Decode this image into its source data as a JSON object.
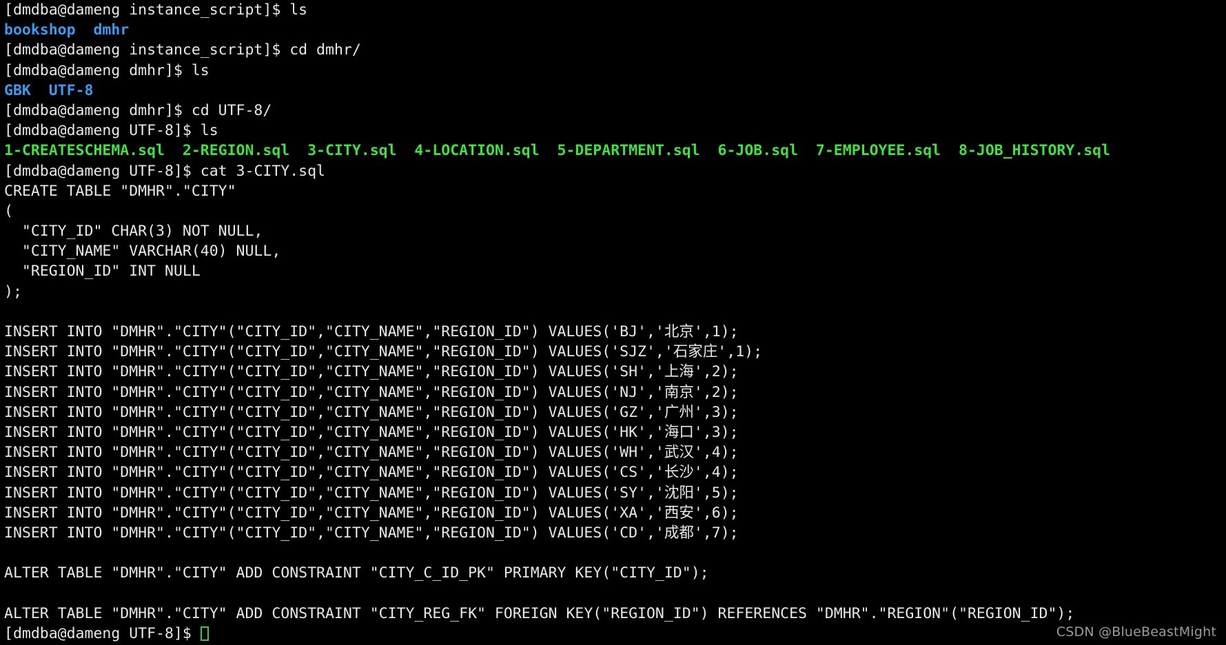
{
  "terminal": {
    "title": "dmdba@dameng terminal",
    "colors": {
      "background": "#000000",
      "foreground": "#e8e8e8",
      "directory": "#3b9bf0",
      "executable": "#3ee33e",
      "cursor": "#33cc33",
      "watermark": "#9b9b9b"
    },
    "prompts": {
      "instance_script": "[dmdba@dameng instance_script]$ ",
      "dmhr": "[dmdba@dameng dmhr]$ ",
      "utf8": "[dmdba@dameng UTF-8]$ "
    },
    "commands": {
      "ls": "ls",
      "cd_dmhr": "cd dmhr/",
      "cd_utf8": "cd UTF-8/",
      "cat_city": "cat 3-CITY.sql"
    },
    "listings": {
      "instance_script": [
        "bookshop",
        "dmhr"
      ],
      "dmhr": [
        "GBK",
        "UTF-8"
      ],
      "utf8": [
        "1-CREATESCHEMA.sql",
        "2-REGION.sql",
        "3-CITY.sql",
        "4-LOCATION.sql",
        "5-DEPARTMENT.sql",
        "6-JOB.sql",
        "7-EMPLOYEE.sql",
        "8-JOB_HISTORY.sql"
      ]
    },
    "file_content": {
      "create_table_header": "CREATE TABLE \"DMHR\".\"CITY\"",
      "open_paren": "(",
      "columns": [
        "  \"CITY_ID\" CHAR(3) NOT NULL,",
        "  \"CITY_NAME\" VARCHAR(40) NULL,",
        "  \"REGION_ID\" INT NULL"
      ],
      "close_paren": ");",
      "insert_prefix": "INSERT INTO \"DMHR\".\"CITY\"(\"CITY_ID\",\"CITY_NAME\",\"REGION_ID\") VALUES(",
      "inserts": [
        "INSERT INTO \"DMHR\".\"CITY\"(\"CITY_ID\",\"CITY_NAME\",\"REGION_ID\") VALUES('BJ','北京',1);",
        "INSERT INTO \"DMHR\".\"CITY\"(\"CITY_ID\",\"CITY_NAME\",\"REGION_ID\") VALUES('SJZ','石家庄',1);",
        "INSERT INTO \"DMHR\".\"CITY\"(\"CITY_ID\",\"CITY_NAME\",\"REGION_ID\") VALUES('SH','上海',2);",
        "INSERT INTO \"DMHR\".\"CITY\"(\"CITY_ID\",\"CITY_NAME\",\"REGION_ID\") VALUES('NJ','南京',2);",
        "INSERT INTO \"DMHR\".\"CITY\"(\"CITY_ID\",\"CITY_NAME\",\"REGION_ID\") VALUES('GZ','广州',3);",
        "INSERT INTO \"DMHR\".\"CITY\"(\"CITY_ID\",\"CITY_NAME\",\"REGION_ID\") VALUES('HK','海口',3);",
        "INSERT INTO \"DMHR\".\"CITY\"(\"CITY_ID\",\"CITY_NAME\",\"REGION_ID\") VALUES('WH','武汉',4);",
        "INSERT INTO \"DMHR\".\"CITY\"(\"CITY_ID\",\"CITY_NAME\",\"REGION_ID\") VALUES('CS','长沙',4);",
        "INSERT INTO \"DMHR\".\"CITY\"(\"CITY_ID\",\"CITY_NAME\",\"REGION_ID\") VALUES('SY','沈阳',5);",
        "INSERT INTO \"DMHR\".\"CITY\"(\"CITY_ID\",\"CITY_NAME\",\"REGION_ID\") VALUES('XA','西安',6);",
        "INSERT INTO \"DMHR\".\"CITY\"(\"CITY_ID\",\"CITY_NAME\",\"REGION_ID\") VALUES('CD','成都',7);"
      ],
      "city_rows": [
        {
          "city_id": "BJ",
          "city_name": "北京",
          "region_id": 1
        },
        {
          "city_id": "SJZ",
          "city_name": "石家庄",
          "region_id": 1
        },
        {
          "city_id": "SH",
          "city_name": "上海",
          "region_id": 2
        },
        {
          "city_id": "NJ",
          "city_name": "南京",
          "region_id": 2
        },
        {
          "city_id": "GZ",
          "city_name": "广州",
          "region_id": 3
        },
        {
          "city_id": "HK",
          "city_name": "海口",
          "region_id": 3
        },
        {
          "city_id": "WH",
          "city_name": "武汉",
          "region_id": 4
        },
        {
          "city_id": "CS",
          "city_name": "长沙",
          "region_id": 4
        },
        {
          "city_id": "SY",
          "city_name": "沈阳",
          "region_id": 5
        },
        {
          "city_id": "XA",
          "city_name": "西安",
          "region_id": 6
        },
        {
          "city_id": "CD",
          "city_name": "成都",
          "region_id": 7
        }
      ],
      "alter_pk": "ALTER TABLE \"DMHR\".\"CITY\" ADD CONSTRAINT \"CITY_C_ID_PK\" PRIMARY KEY(\"CITY_ID\");",
      "alter_fk": "ALTER TABLE \"DMHR\".\"CITY\" ADD CONSTRAINT \"CITY_REG_FK\" FOREIGN KEY(\"REGION_ID\") REFERENCES \"DMHR\".\"REGION\"(\"REGION_ID\");"
    },
    "listing_lines": {
      "instance_script_joined": "bookshop  dmhr",
      "dmhr_joined": "GBK  UTF-8",
      "utf8_joined": "1-CREATESCHEMA.sql  2-REGION.sql  3-CITY.sql  4-LOCATION.sql  5-DEPARTMENT.sql  6-JOB.sql  7-EMPLOYEE.sql  8-JOB_HISTORY.sql"
    },
    "watermark": "CSDN @BlueBeastMight"
  }
}
